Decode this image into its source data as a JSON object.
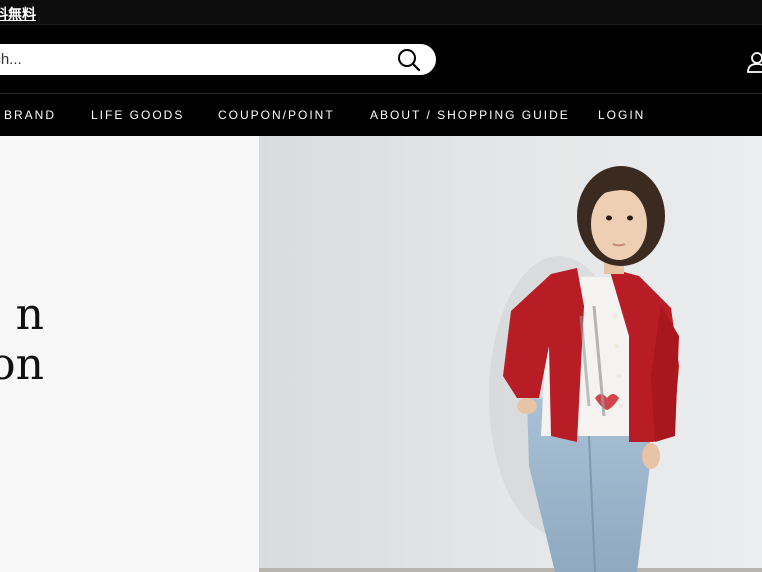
{
  "announcement": {
    "text": "料無料"
  },
  "search": {
    "placeholder": "arch..."
  },
  "nav": {
    "items": [
      {
        "label": "BRAND"
      },
      {
        "label": "LIFE GOODS"
      },
      {
        "label": "COUPON/POINT"
      },
      {
        "label": "ABOUT / SHOPPING GUIDE"
      },
      {
        "label": "LOGIN"
      }
    ]
  },
  "hero": {
    "line1": "n",
    "line2": "on"
  },
  "icons": {
    "search": "search-icon",
    "account": "user-icon"
  },
  "colors": {
    "header_bg": "#000000",
    "hero_left_bg": "#f8f8f8",
    "cardigan_red": "#b81c24",
    "jeans_blue": "#9fb8cf"
  }
}
